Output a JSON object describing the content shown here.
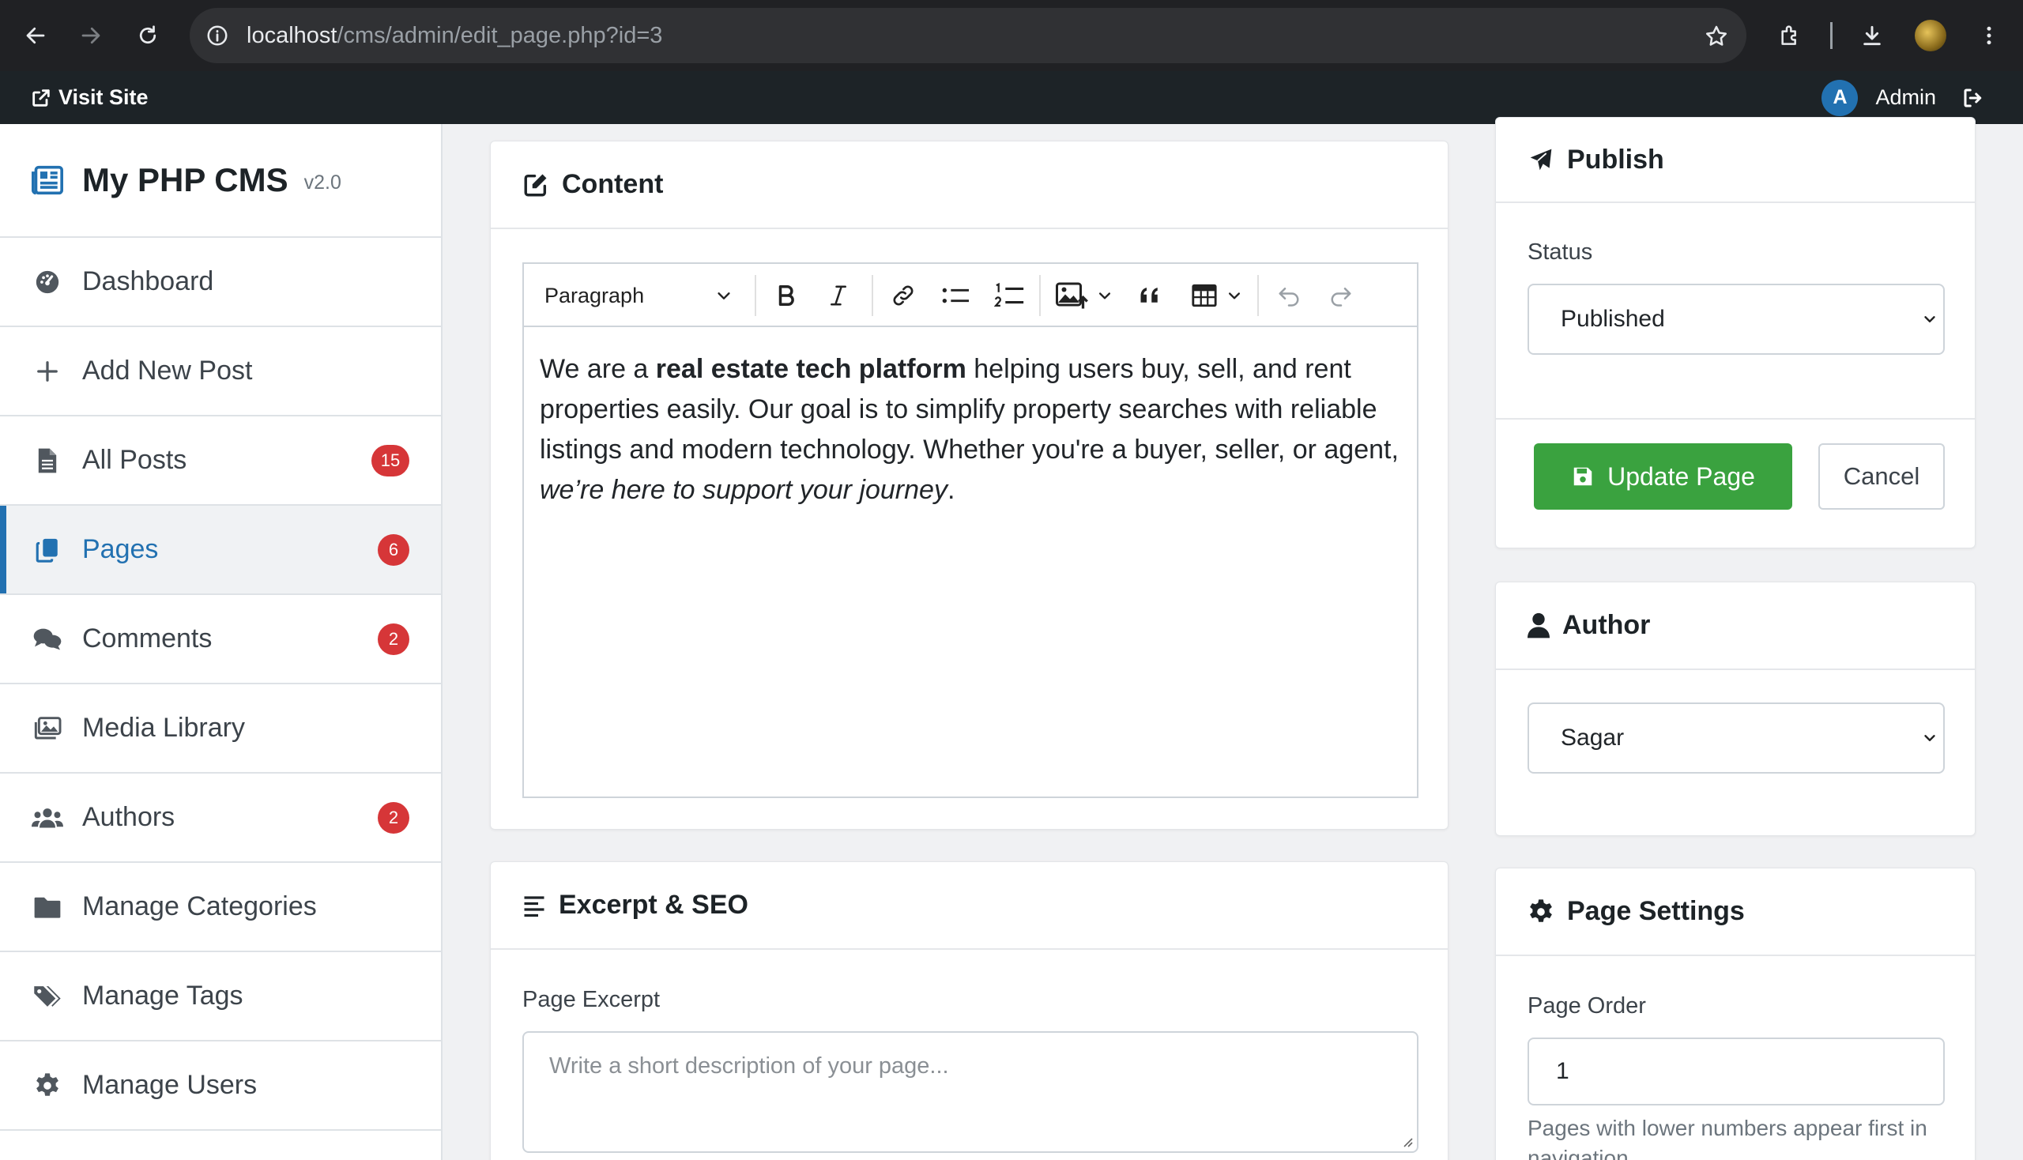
{
  "browser": {
    "url_host": "localhost",
    "url_path": "/cms/admin/edit_page.php?id=3"
  },
  "adminbar": {
    "visit_site": "Visit Site",
    "avatar_letter": "A",
    "user_name": "Admin"
  },
  "brand": {
    "title": "My PHP CMS",
    "version": "v2.0"
  },
  "sidebar": {
    "items": [
      {
        "label": "Dashboard",
        "icon": "dashboard-icon"
      },
      {
        "label": "Add New Post",
        "icon": "plus-icon"
      },
      {
        "label": "All Posts",
        "icon": "file-icon",
        "badge": "15"
      },
      {
        "label": "Pages",
        "icon": "copy-icon",
        "badge": "6",
        "active": true
      },
      {
        "label": "Comments",
        "icon": "comments-icon",
        "badge": "2"
      },
      {
        "label": "Media Library",
        "icon": "images-icon"
      },
      {
        "label": "Authors",
        "icon": "users-icon",
        "badge": "2"
      },
      {
        "label": "Manage Categories",
        "icon": "folder-icon"
      },
      {
        "label": "Manage Tags",
        "icon": "tags-icon"
      },
      {
        "label": "Manage Users",
        "icon": "gear-icon"
      }
    ]
  },
  "content_card": {
    "title": "Content",
    "block_format": "Paragraph",
    "text_pre": "We are a ",
    "text_bold": "real estate tech platform",
    "text_mid": " helping users buy, sell, and rent properties easily. Our goal is to simplify property searches with reliable listings and modern technology. Whether you're a buyer, seller, or agent, ",
    "text_italic": "we’re here to support your journey",
    "text_post": "."
  },
  "excerpt_card": {
    "title": "Excerpt & SEO",
    "excerpt_label": "Page Excerpt",
    "excerpt_placeholder": "Write a short description of your page..."
  },
  "publish_card": {
    "title": "Publish",
    "status_label": "Status",
    "status_value": "Published",
    "update_button": "Update Page",
    "cancel_button": "Cancel"
  },
  "author_card": {
    "title": "Author",
    "author_value": "Sagar"
  },
  "settings_card": {
    "title": "Page Settings",
    "order_label": "Page Order",
    "order_value": "1",
    "order_help": "Pages with lower numbers appear first in navigation."
  },
  "colors": {
    "primary": "#2271b1",
    "success": "#3aa23f",
    "badge": "#d63638",
    "adminbar": "#1d2327"
  }
}
